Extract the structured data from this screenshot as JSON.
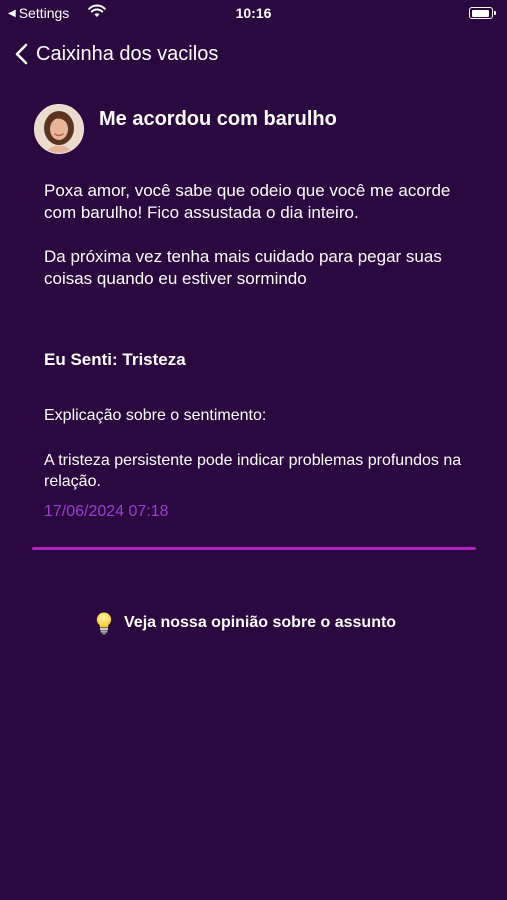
{
  "status_bar": {
    "back_app": "Settings",
    "time": "10:16"
  },
  "nav": {
    "title": "Caixinha dos vacilos"
  },
  "post": {
    "title": "Me acordou com barulho",
    "paragraphs": [
      "Poxa amor, você sabe que odeio que você me acorde com barulho! Fico assustada o dia inteiro.",
      "Da próxima vez tenha mais cuidado para pegar suas coisas quando eu estiver sormindo"
    ],
    "feeling": "Eu Senti: Tristeza",
    "explanation_label": "Explicação sobre o sentimento:",
    "explanation_text": "A tristeza persistente pode indicar problemas profundos na relação.",
    "timestamp": "17/06/2024 07:18"
  },
  "opinion": {
    "label": "Veja nossa opinião sobre o assunto"
  },
  "colors": {
    "background": "#2c0840",
    "accent": "#b01fbf",
    "timestamp": "#9a3dcf"
  }
}
